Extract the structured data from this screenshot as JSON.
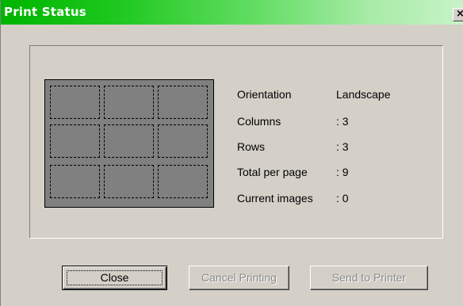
{
  "window": {
    "title": "Print Status",
    "close_glyph": "×"
  },
  "preview": {
    "columns": 3,
    "rows": 3
  },
  "info": [
    {
      "label": "Orientation",
      "value": "Landscape"
    },
    {
      "label": "Columns",
      "value": ": 3"
    },
    {
      "label": "Rows",
      "value": ": 3"
    },
    {
      "label": "Total per page",
      "value": ": 9"
    },
    {
      "label": "Current images",
      "value": ": 0"
    }
  ],
  "buttons": {
    "close": "Close",
    "cancel_printing": "Cancel Printing",
    "send_to_printer": "Send to Printer"
  },
  "colors": {
    "title_gradient_start": "#00b400",
    "window_bg": "#d4d0c8",
    "preview_bg": "#808080"
  }
}
